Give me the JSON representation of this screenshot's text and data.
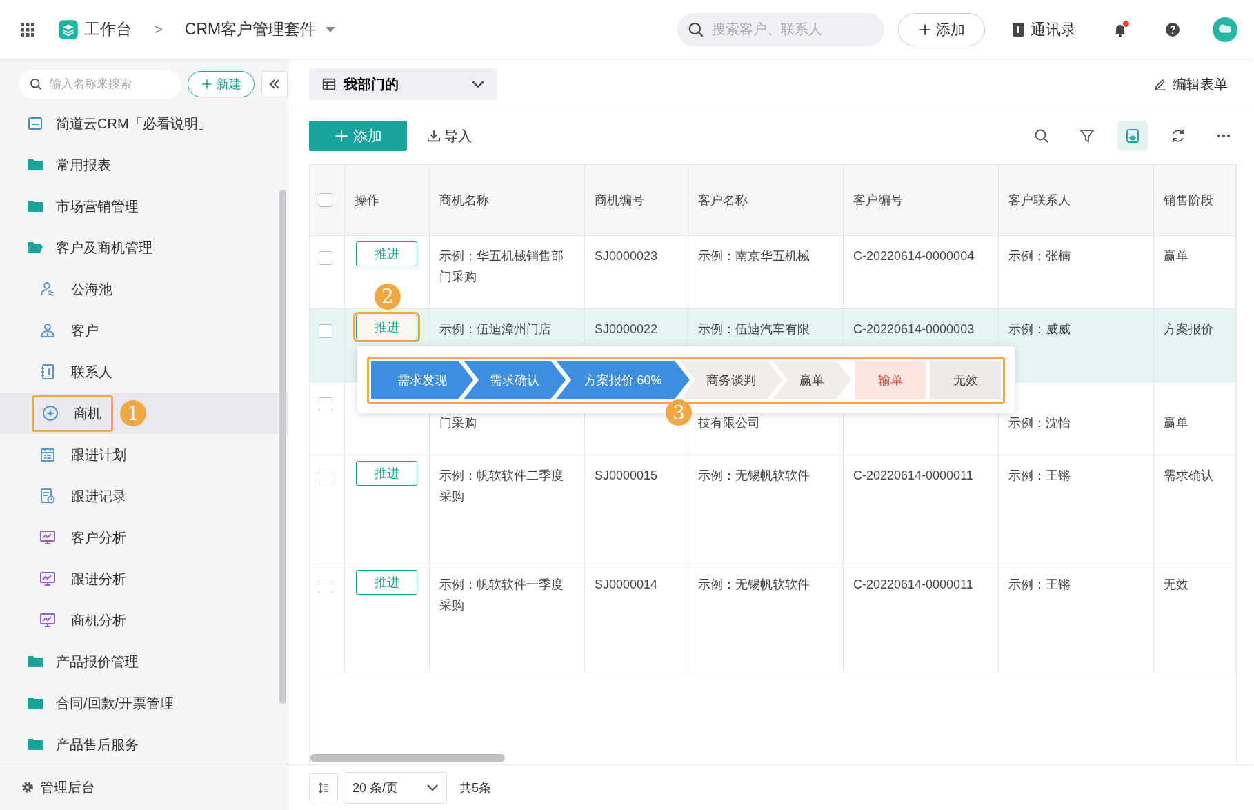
{
  "topbar": {
    "workspace": "工作台",
    "separator": ">",
    "app": "CRM客户管理套件",
    "search": {
      "placeholder": "搜索客户、联系人"
    },
    "add_button": "添加",
    "contacts_link": "通讯录",
    "notification_dot": true
  },
  "sidebar": {
    "search": {
      "placeholder": "输入名称来搜索"
    },
    "new_button": "新建",
    "items": [
      {
        "kind": "doc",
        "label": "简道云CRM「必看说明」",
        "selected": false
      },
      {
        "kind": "folder",
        "label": "常用报表",
        "selected": false,
        "expanded": false
      },
      {
        "kind": "folder",
        "label": "市场营销管理",
        "selected": false,
        "expanded": false
      },
      {
        "kind": "folder",
        "label": "客户及商机管理",
        "selected": false,
        "expanded": true,
        "children": [
          {
            "kind": "pool",
            "label": "公海池",
            "selected": false
          },
          {
            "kind": "customer",
            "label": "客户",
            "selected": false
          },
          {
            "kind": "contact",
            "label": "联系人",
            "selected": false
          },
          {
            "kind": "opportunity",
            "label": "商机",
            "selected": true,
            "callout": "1"
          },
          {
            "kind": "plan",
            "label": "跟进计划",
            "selected": false
          },
          {
            "kind": "record",
            "label": "跟进记录",
            "selected": false
          },
          {
            "kind": "chart",
            "label": "客户分析",
            "selected": false
          },
          {
            "kind": "chart",
            "label": "跟进分析",
            "selected": false
          },
          {
            "kind": "chart",
            "label": "商机分析",
            "selected": false
          }
        ]
      },
      {
        "kind": "folder",
        "label": "产品报价管理",
        "selected": false,
        "expanded": false
      },
      {
        "kind": "folder",
        "label": "合同/回款/开票管理",
        "selected": false,
        "expanded": false
      },
      {
        "kind": "folder",
        "label": "产品售后服务",
        "selected": false,
        "expanded": false
      }
    ],
    "footer": "管理后台"
  },
  "view": {
    "name": "我部门的",
    "edit_form": "编辑表单"
  },
  "toolbar": {
    "add_button": "添加",
    "import_button": "导入",
    "display_toggle_on": true
  },
  "table": {
    "header_checked": false,
    "columns": [
      "操作",
      "商机名称",
      "商机编号",
      "客户名称",
      "客户编号",
      "客户联系人",
      "销售阶段"
    ],
    "rows": [
      {
        "selected": false,
        "checked": false,
        "cells": [
          "推进",
          "示例：华五机械销售部门采购",
          "SJ0000023",
          "示例：南京华五机械",
          "C-20220614-0000004",
          "示例：张楠",
          "赢单"
        ]
      },
      {
        "selected": true,
        "checked": false,
        "action_callout": "2",
        "cells": [
          "推进",
          "示例：伍迪漳州门店",
          "SJ0000022",
          "示例：伍迪汽车有限",
          "C-20220614-0000003",
          "示例：威威",
          "方案报价"
        ]
      },
      {
        "selected": false,
        "checked": false,
        "covered": true,
        "cells": [
          "",
          "门采购",
          "",
          "技有限公司",
          "",
          "示例：沈怡",
          "赢单"
        ]
      },
      {
        "selected": false,
        "checked": false,
        "cells": [
          "推进",
          "示例：帆软软件二季度采购",
          "SJ0000015",
          "示例：无锡帆软软件",
          "C-20220614-0000011",
          "示例：王锵",
          "需求确认"
        ]
      },
      {
        "selected": false,
        "checked": false,
        "cells": [
          "推进",
          "示例：帆软软件一季度采购",
          "SJ0000014",
          "示例：无锡帆软软件",
          "C-20220614-0000011",
          "示例：王锵",
          "无效"
        ]
      }
    ]
  },
  "stage_popup": {
    "callout": "3",
    "stages": [
      {
        "kind": "done",
        "label": "需求发现"
      },
      {
        "kind": "done",
        "label": "需求确认"
      },
      {
        "kind": "done",
        "label": "方案报价 60%"
      },
      {
        "kind": "todo",
        "label": "商务谈判"
      },
      {
        "kind": "todo",
        "label": "赢单"
      },
      {
        "kind": "lost",
        "label": "输单"
      },
      {
        "kind": "void",
        "label": "无效"
      }
    ]
  },
  "pager": {
    "page_size": "20 条/页",
    "total": "共5条"
  }
}
